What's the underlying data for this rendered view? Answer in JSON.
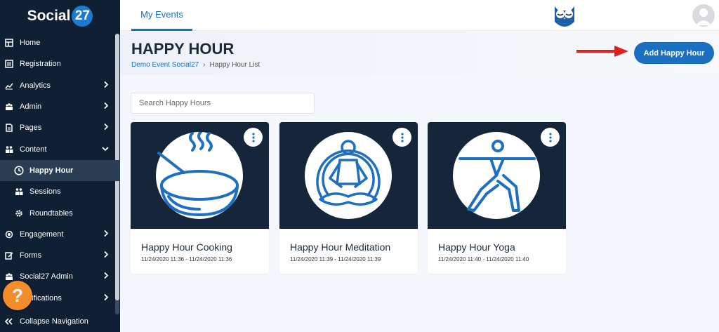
{
  "brand": {
    "name": "Social",
    "badge": "27"
  },
  "topbar": {
    "tab": "My Events"
  },
  "header": {
    "title": "HAPPY HOUR",
    "breadcrumb": [
      "Demo Event Social27",
      "Happy Hour List"
    ],
    "add_button": "Add Happy Hour"
  },
  "search": {
    "placeholder": "Search Happy Hours",
    "value": ""
  },
  "sidebar": {
    "items": [
      {
        "label": "Home",
        "icon": "home-icon"
      },
      {
        "label": "Registration",
        "icon": "registration-icon"
      },
      {
        "label": "Analytics",
        "icon": "analytics-icon"
      },
      {
        "label": "Admin",
        "icon": "admin-icon"
      },
      {
        "label": "Pages",
        "icon": "pages-icon"
      },
      {
        "label": "Content",
        "icon": "content-icon"
      },
      {
        "label": "Happy Hour",
        "icon": "clock-icon"
      },
      {
        "label": "Sessions",
        "icon": "sessions-icon"
      },
      {
        "label": "Roundtables",
        "icon": "gear-icon"
      },
      {
        "label": "Engagement",
        "icon": "engagement-icon"
      },
      {
        "label": "Forms",
        "icon": "forms-icon"
      },
      {
        "label": "Social27 Admin",
        "icon": "admin-icon"
      },
      {
        "label": "Notifications",
        "icon": "bell-icon"
      }
    ],
    "collapse": "Collapse Navigation"
  },
  "cards": [
    {
      "title": "Happy Hour Cooking",
      "date": "11/24/2020 11:36 - 11/24/2020 11:36",
      "icon": "cooking-pan-icon"
    },
    {
      "title": "Happy Hour Meditation",
      "date": "11/24/2020 11:39 - 11/24/2020 11:39",
      "icon": "meditation-icon"
    },
    {
      "title": "Happy Hour Yoga",
      "date": "11/24/2020 11:40 - 11/24/2020 11:40",
      "icon": "yoga-icon"
    }
  ],
  "colors": {
    "sidebar": "#0f2034",
    "accent": "#1a6fc1",
    "help": "#f38d2b",
    "arrow": "#e02020"
  }
}
